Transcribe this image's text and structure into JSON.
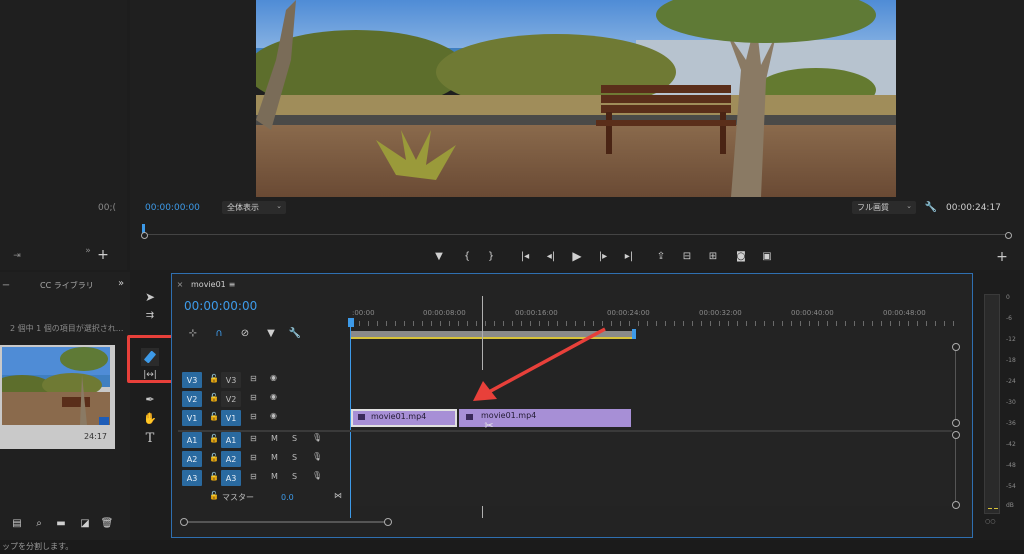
{
  "left_panel": {
    "timecode": "00;("
  },
  "program_monitor": {
    "timecode_left": "00:00:00:00",
    "zoom_select": "全体表示",
    "quality_select": "フル画質",
    "timecode_right": "00:00:24:17",
    "controls": [
      "marker",
      "in",
      "out",
      "go-in",
      "step-back",
      "play",
      "step-forward",
      "go-out",
      "lift",
      "extract",
      "overwrite",
      "export-frame",
      "compare"
    ]
  },
  "project_panel": {
    "tabs": [
      "ー",
      "CC ライブラリ"
    ],
    "status": "2 個中 1 個の項目が選択され...",
    "thumb_duration": "24:17"
  },
  "timeline": {
    "sequence_name": "movie01",
    "timecode": "00:00:00:00",
    "ruler_labels": [
      ":00:00",
      "00:00:08:00",
      "00:00:16:00",
      "00:00:24:00",
      "00:00:32:00",
      "00:00:40:00",
      "00:00:48:00"
    ],
    "video_tracks": [
      {
        "name": "V3",
        "source": "V3"
      },
      {
        "name": "V2",
        "source": "V2"
      },
      {
        "name": "V1",
        "source": "V1"
      }
    ],
    "audio_tracks": [
      {
        "name": "A1",
        "source": "A1",
        "m": "M",
        "s": "S"
      },
      {
        "name": "A2",
        "source": "A2",
        "m": "M",
        "s": "S"
      },
      {
        "name": "A3",
        "source": "A3",
        "m": "M",
        "s": "S"
      }
    ],
    "master_label": "マスター",
    "master_value": "0.0",
    "clips": [
      {
        "name": "movie01.mp4",
        "color": "#a78fd6"
      },
      {
        "name": "movie01.mp4",
        "color": "#a78fd6"
      }
    ]
  },
  "meter_labels": [
    "0",
    "-6",
    "-12",
    "-18",
    "-24",
    "-30",
    "-36",
    "-42",
    "-48",
    "-54",
    "dB"
  ],
  "status_bar": "ップを分割します。",
  "colors": {
    "accent_blue": "#3d9ae8",
    "clip_purple": "#a78fd6",
    "highlight_red": "#e8403a"
  }
}
